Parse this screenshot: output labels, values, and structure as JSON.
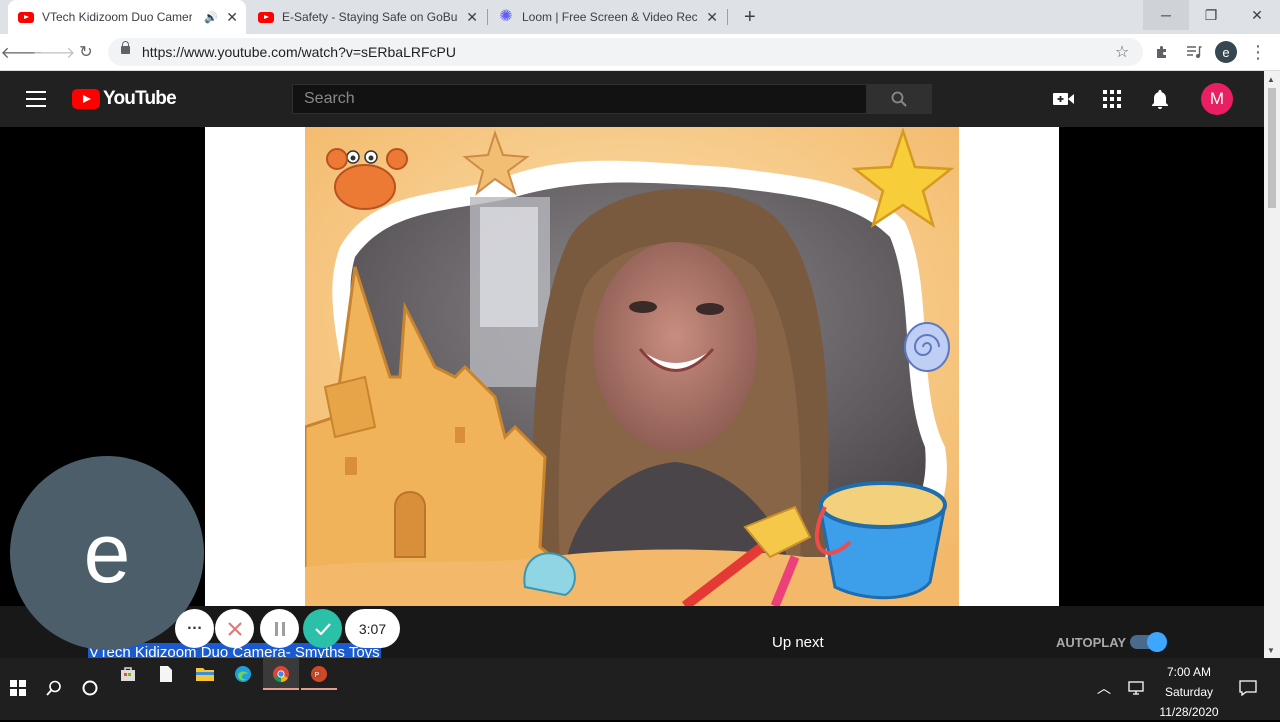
{
  "browser": {
    "tabs": [
      {
        "title": "VTech Kidizoom Duo Camera",
        "active": true,
        "favicon": "youtube-icon",
        "audio": true
      },
      {
        "title": "E-Safety - Staying Safe on GoBub",
        "active": false,
        "favicon": "youtube-icon"
      },
      {
        "title": "Loom | Free Screen & Video Reco",
        "active": false,
        "favicon": "loom-icon"
      }
    ],
    "new_tab_label": "+",
    "url": "https://www.youtube.com/watch?v=sERbaLRFcPU",
    "profile_initial": "e"
  },
  "youtube": {
    "logo_text": "YouTube",
    "search_placeholder": "Search",
    "avatar_initial": "M",
    "up_next_label": "Up next",
    "autoplay_label": "AUTOPLAY",
    "autoplay_on": true,
    "video_title": "VTech Kidizoom Duo Camera- Smyths Toys"
  },
  "loom": {
    "bubble_initial": "e",
    "timer": "3:07"
  },
  "taskbar": {
    "time": "7:00 AM",
    "day": "Saturday",
    "date": "11/28/2020"
  },
  "colors": {
    "youtube_red": "#ff0000",
    "loom_confirm": "#2bc0a8",
    "avatar_m": "#e91e63",
    "autoplay_blue": "#3ea6ff"
  }
}
